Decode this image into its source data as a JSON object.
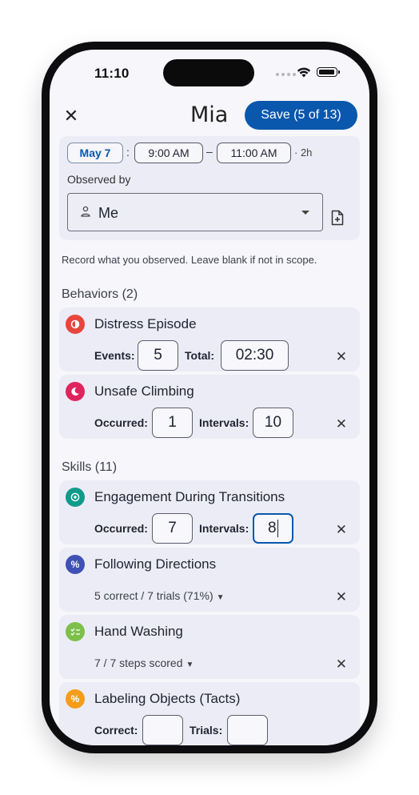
{
  "status": {
    "time": "11:10"
  },
  "header": {
    "title": "Mia",
    "save_label": "Save (5 of 13)"
  },
  "session": {
    "date": "May 7",
    "colon": ":",
    "start": "9:00 AM",
    "dash": "–",
    "end": "11:00 AM",
    "duration": "· 2h",
    "observed_label": "Observed by",
    "observed_value": "Me"
  },
  "hint": "Record what you observed. Leave blank if not in scope.",
  "behaviors": {
    "title": "Behaviors (2)",
    "items": [
      {
        "name": "Distress Episode",
        "icon": "distress-icon",
        "color": "#e8453c",
        "f1_label": "Events:",
        "f1_value": "5",
        "f2_label": "Total:",
        "f2_value": "02:30"
      },
      {
        "name": "Unsafe Climbing",
        "icon": "moon-icon",
        "color": "#e0245e",
        "f1_label": "Occurred:",
        "f1_value": "1",
        "f2_label": "Intervals:",
        "f2_value": "10"
      }
    ]
  },
  "skills": {
    "title": "Skills (11)",
    "items": [
      {
        "name": "Engagement During Transitions",
        "icon": "target-icon",
        "color": "#109a8a",
        "f1_label": "Occurred:",
        "f1_value": "7",
        "f2_label": "Intervals:",
        "f2_value": "8"
      },
      {
        "name": "Following Directions",
        "icon": "percent-icon",
        "color": "#3f51b5",
        "summary": "5 correct / 7 trials (71%)"
      },
      {
        "name": "Hand Washing",
        "icon": "checklist-icon",
        "color": "#7cc04a",
        "summary": "7 / 7 steps scored"
      },
      {
        "name": "Labeling Objects (Tacts)",
        "icon": "percent-icon",
        "color": "#f59c1a",
        "f1_label": "Correct:",
        "f1_value": "",
        "f2_label": "Trials:",
        "f2_value": ""
      }
    ]
  },
  "icons": {
    "close": "✕",
    "remove": "✕",
    "chevron": "⌄"
  },
  "colors": {
    "accent": "#0a58ad",
    "card": "#ececf6",
    "background": "#f6f6fb"
  }
}
